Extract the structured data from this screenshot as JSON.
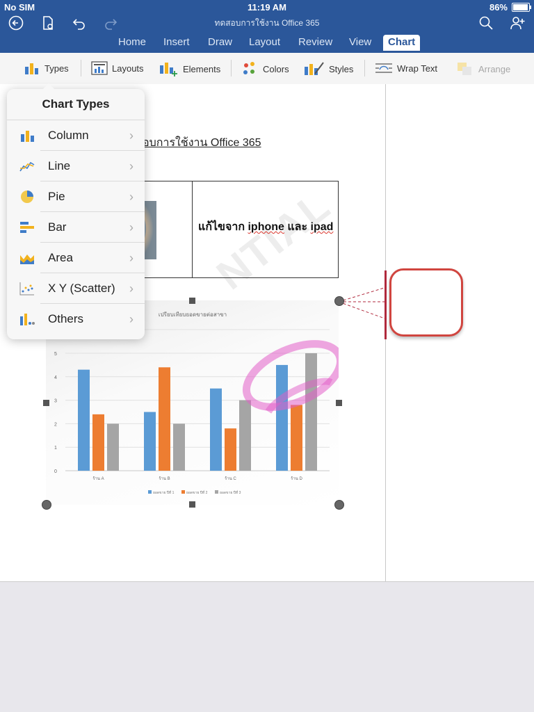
{
  "status": {
    "carrier": "No SIM",
    "time": "11:19 AM",
    "battery": "86%"
  },
  "document_title": "ทดสอบการใช้งาน Office 365",
  "tabs": [
    "Home",
    "Insert",
    "Draw",
    "Layout",
    "Review",
    "View",
    "Chart"
  ],
  "active_tab": "Chart",
  "ribbon": {
    "types": "Types",
    "layouts": "Layouts",
    "elements": "Elements",
    "colors": "Colors",
    "styles": "Styles",
    "wrap_text": "Wrap Text",
    "arrange": "Arrange"
  },
  "doc": {
    "heading": "อบการใช้งาน Office 365",
    "cell2_prefix": "แก้ไขจาก ",
    "cell2_w1": "iphone",
    "cell2_mid": " และ ",
    "cell2_w2": "ipad",
    "watermark": "NTIAL"
  },
  "popover": {
    "title": "Chart Types",
    "items": [
      {
        "label": "Column",
        "icon": "column-chart-icon"
      },
      {
        "label": "Line",
        "icon": "line-chart-icon"
      },
      {
        "label": "Pie",
        "icon": "pie-chart-icon"
      },
      {
        "label": "Bar",
        "icon": "bar-chart-icon"
      },
      {
        "label": "Area",
        "icon": "area-chart-icon"
      },
      {
        "label": "X Y (Scatter)",
        "icon": "scatter-chart-icon"
      },
      {
        "label": "Others",
        "icon": "others-chart-icon"
      }
    ]
  },
  "colors": {
    "brand": "#2b579a",
    "series1": "#5b9bd5",
    "series2": "#ed7d31",
    "series3": "#a5a5a5",
    "ink": "#e25ec8",
    "callout": "#d0453f"
  },
  "chart_data": {
    "type": "bar",
    "title": "เปรียบเทียบยอดขายต่อสาขา",
    "categories": [
      "ร้าน A",
      "ร้าน B",
      "ร้าน C",
      "ร้าน D"
    ],
    "series": [
      {
        "name": "ยอดขาย ปีที่ 1",
        "values": [
          4.3,
          2.5,
          3.5,
          4.5
        ]
      },
      {
        "name": "ยอดขาย ปีที่ 2",
        "values": [
          2.4,
          4.4,
          1.8,
          2.8
        ]
      },
      {
        "name": "ยอดขาย ปีที่ 3",
        "values": [
          2.0,
          2.0,
          3.0,
          5.0
        ]
      }
    ],
    "y_ticks": [
      "0",
      "1",
      "2",
      "3",
      "4",
      "5"
    ],
    "ylim": [
      0,
      5
    ],
    "grid": true,
    "legend": "bottom"
  }
}
